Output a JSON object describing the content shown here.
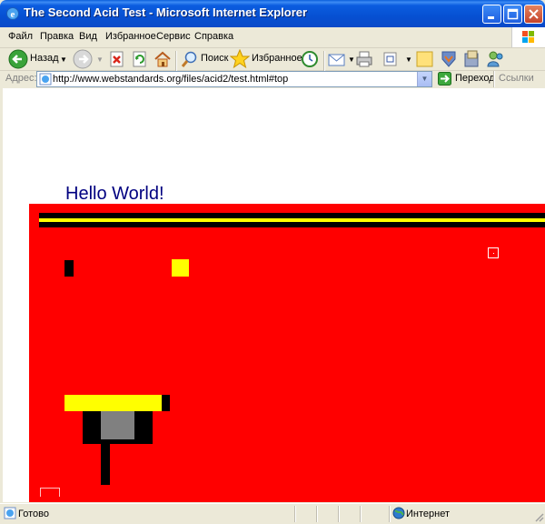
{
  "window": {
    "title": "The Second Acid Test - Microsoft Internet Explorer"
  },
  "menu": [
    "Файл",
    "Правка",
    "Вид",
    "Избранное",
    "Сервис",
    "Справка"
  ],
  "toolbar": {
    "back_label": "Назад",
    "search_label": "Поиск",
    "favorites_label": "Избранное"
  },
  "address": {
    "label": "Адрес:",
    "url": "http://www.webstandards.org/files/acid2/test.html#top",
    "go_label": "Переход",
    "links_label": "Ссылки"
  },
  "page": {
    "heading": "Hello World!"
  },
  "status": {
    "text": "Готово",
    "zone": "Интернет"
  },
  "colors": {
    "red": "#FF0000",
    "yellow": "#FFFF00",
    "black": "#000000",
    "gray": "#808080",
    "heading": "#000080"
  }
}
